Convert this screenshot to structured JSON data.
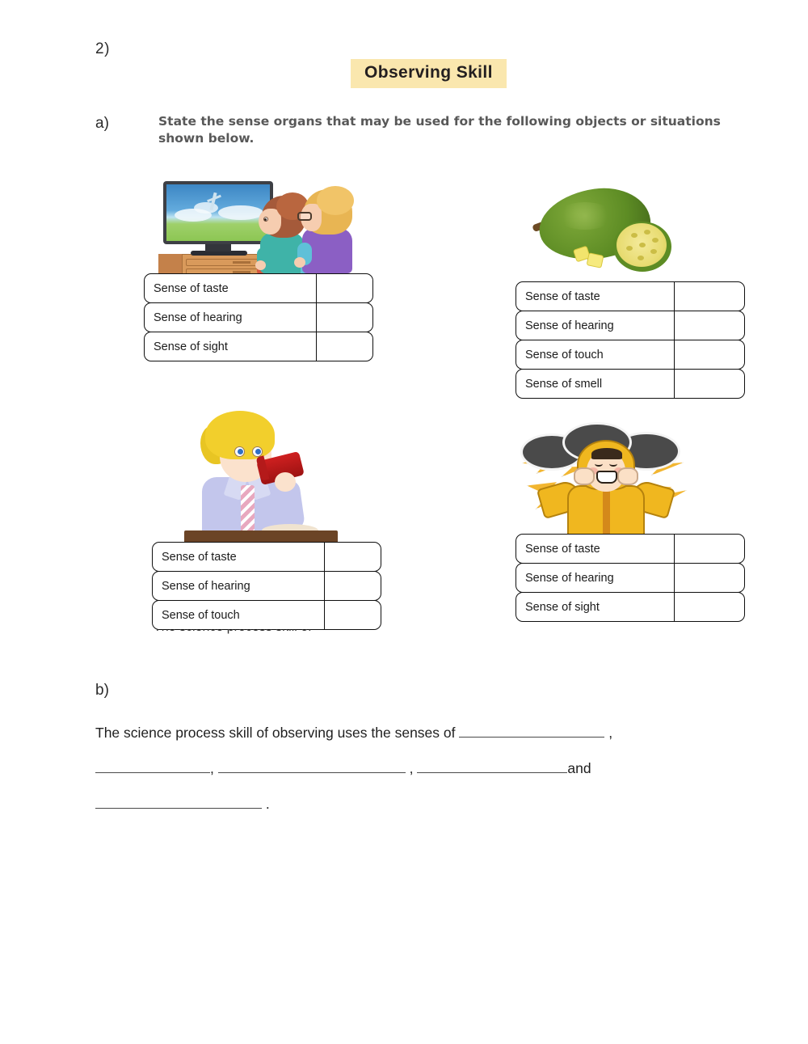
{
  "page": {
    "question_number": "2)",
    "title": "Observing Skill",
    "title_highlight_color": "#fae7ae"
  },
  "part_a": {
    "label": "a)",
    "instruction": "State the sense organs that may be used for the following objects or situations shown below.",
    "items": [
      {
        "id": "tv",
        "picture_name": "children-watching-tv-illustration",
        "rows": [
          {
            "label": "Sense of taste",
            "answer": ""
          },
          {
            "label": "Sense of hearing",
            "answer": ""
          },
          {
            "label": "Sense of sight",
            "answer": ""
          }
        ]
      },
      {
        "id": "jackfruit",
        "picture_name": "green-jackfruit-with-cut-half-illustration",
        "rows": [
          {
            "label": "Sense of taste",
            "answer": ""
          },
          {
            "label": "Sense of hearing",
            "answer": ""
          },
          {
            "label": "Sense of touch",
            "answer": ""
          },
          {
            "label": "Sense of smell",
            "answer": ""
          }
        ]
      },
      {
        "id": "drinking",
        "picture_name": "boy-drinking-from-red-cup-illustration",
        "rows": [
          {
            "label": "Sense of taste",
            "answer": ""
          },
          {
            "label": "Sense of hearing",
            "answer": ""
          },
          {
            "label": "Sense of touch",
            "answer": ""
          }
        ]
      },
      {
        "id": "thunderstorm",
        "picture_name": "child-covering-ears-in-thunderstorm-illustration",
        "rows": [
          {
            "label": "Sense of taste",
            "answer": ""
          },
          {
            "label": "Sense of hearing",
            "answer": ""
          },
          {
            "label": "Sense of sight",
            "answer": ""
          }
        ]
      }
    ]
  },
  "part_b": {
    "label": "b)",
    "sentence_start": "The science process skill of observing uses the senses of",
    "comma_1": ",",
    "comma_2": ",",
    "comma_3": ",",
    "conjunction": "and",
    "period": ".",
    "blanks": [
      "",
      "",
      "",
      "",
      ""
    ]
  },
  "artifacts": {
    "clipped_text": "The science process skill of"
  }
}
